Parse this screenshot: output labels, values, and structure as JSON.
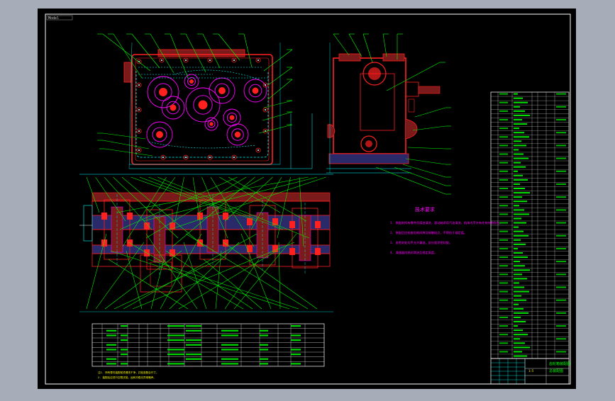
{
  "window": {
    "background": "#a7acb9",
    "canvas_color": "#000000"
  },
  "drawing": {
    "tab_label": "Model",
    "tech_title": "技术要求",
    "tech_notes": [
      "1. 装配前所有零件用煤油清洗，滚动轴承用汽油清洗，机体内不许有任何杂物存在。",
      "2. 装配后应检查齿侧间隙及接触斑点，不得低于规定值。",
      "3. 各密封处均不允许漏油，剖分面涂密封胶。",
      "4. 减速器内装润滑油至规定高度。"
    ],
    "bottom_notes": [
      "注1. 所有零件装配前须清洗干净，并检查配合尺寸。",
      "2. 装配后应进行空载试验，运转平稳无异常噪声。"
    ],
    "title_block": {
      "line1": "齿轮箱装配图",
      "line2": "总装配图",
      "scale": "1:5"
    },
    "colors": {
      "frame": "#ffffff",
      "outline": "#ff2020",
      "gear": "#ff00ff",
      "leader": "#00ff00",
      "dimension": "#00ffff",
      "text": "#ffffff",
      "tech_text": "#ff00ff",
      "fill_dark": "#7a1a1a",
      "fill_blue": "#2a2a6a"
    }
  }
}
